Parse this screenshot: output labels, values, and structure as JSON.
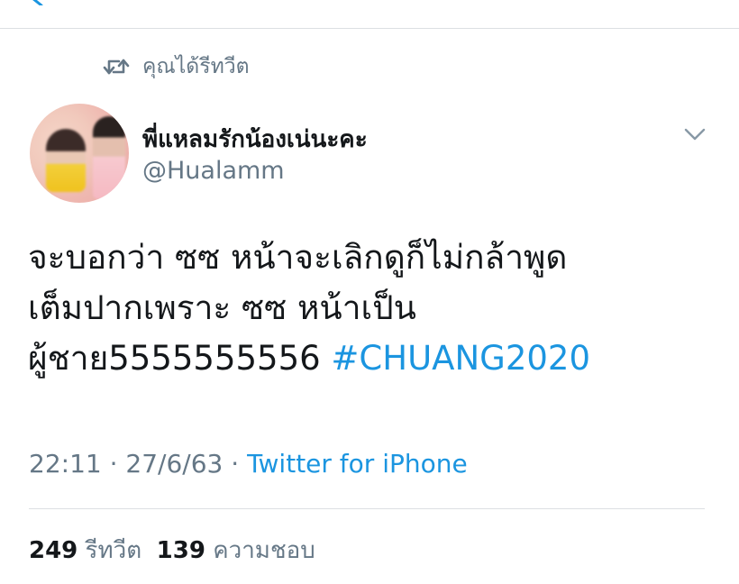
{
  "social_context": {
    "retweet_label": "คุณได้รีทวีต",
    "icon": "retweet-icon"
  },
  "author": {
    "display_name": "พี่แหลมรักน้องเน่นะคะ",
    "handle": "@Hualamm",
    "avatar_icon": "avatar"
  },
  "tweet": {
    "text": "จะบอกว่า ซซ หน้าจะเลิกดูก็ไม่กล้าพูด\nเต็มปากเพราะ ซซ หน้าเป็น\nผู้ชาย5555555556 ",
    "hashtag": "#CHUANG2020"
  },
  "meta": {
    "time": "22:11",
    "date": "27/6/63",
    "separator": " · ",
    "source": "Twitter for iPhone"
  },
  "stats": {
    "retweets": "249",
    "retweets_label": "รีทวีต",
    "likes": "139",
    "likes_label": "ความชอบ"
  },
  "colors": {
    "link": "#1b95e0",
    "secondary": "#657786",
    "primary": "#14171a",
    "divider": "#dcdfe3"
  }
}
